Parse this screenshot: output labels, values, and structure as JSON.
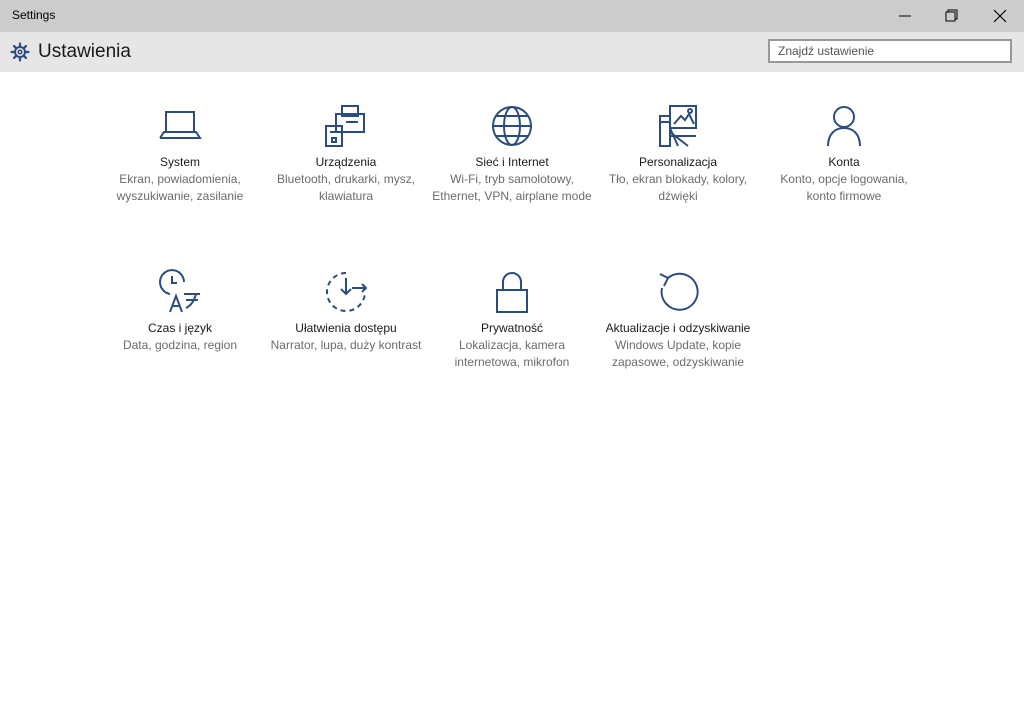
{
  "window": {
    "title": "Settings",
    "controls": {
      "minimize_icon": "minimize-icon",
      "maximize_icon": "restore-icon",
      "close_icon": "close-icon"
    }
  },
  "header": {
    "title": "Ustawienia",
    "icon": "gear-icon",
    "search": {
      "value": "",
      "placeholder": "Znajdź ustawienie"
    }
  },
  "colors": {
    "accent": "#2b4c7e",
    "titlebar": "#cccccc",
    "header": "#e6e6e6"
  },
  "tiles": [
    {
      "name": "System",
      "desc": "Ekran, powiadomienia, wyszukiwanie, zasilanie",
      "icon": "laptop-icon"
    },
    {
      "name": "Urządzenia",
      "desc": "Bluetooth, drukarki, mysz, klawiatura",
      "icon": "printer-icon"
    },
    {
      "name": "Sieć i Internet",
      "desc": "Wi-Fi, tryb samolotowy, Ethernet, VPN, airplane mode",
      "icon": "globe-icon"
    },
    {
      "name": "Personalizacja",
      "desc": "Tło, ekran blokady, kolory, dźwięki",
      "icon": "personalization-icon"
    },
    {
      "name": "Konta",
      "desc": "Konto, opcje logowania, konto firmowe",
      "icon": "person-icon"
    },
    {
      "name": "Czas i język",
      "desc": "Data, godzina, region",
      "icon": "time-language-icon"
    },
    {
      "name": "Ułatwienia dostępu",
      "desc": "Narrator, lupa, duży kontrast",
      "icon": "accessibility-icon"
    },
    {
      "name": "Prywatność",
      "desc": "Lokalizacja, kamera internetowa, mikrofon",
      "icon": "lock-icon"
    },
    {
      "name": "Aktualizacje i odzyskiwanie",
      "desc": "Windows Update, kopie zapasowe, odzyskiwanie",
      "icon": "refresh-icon"
    }
  ]
}
